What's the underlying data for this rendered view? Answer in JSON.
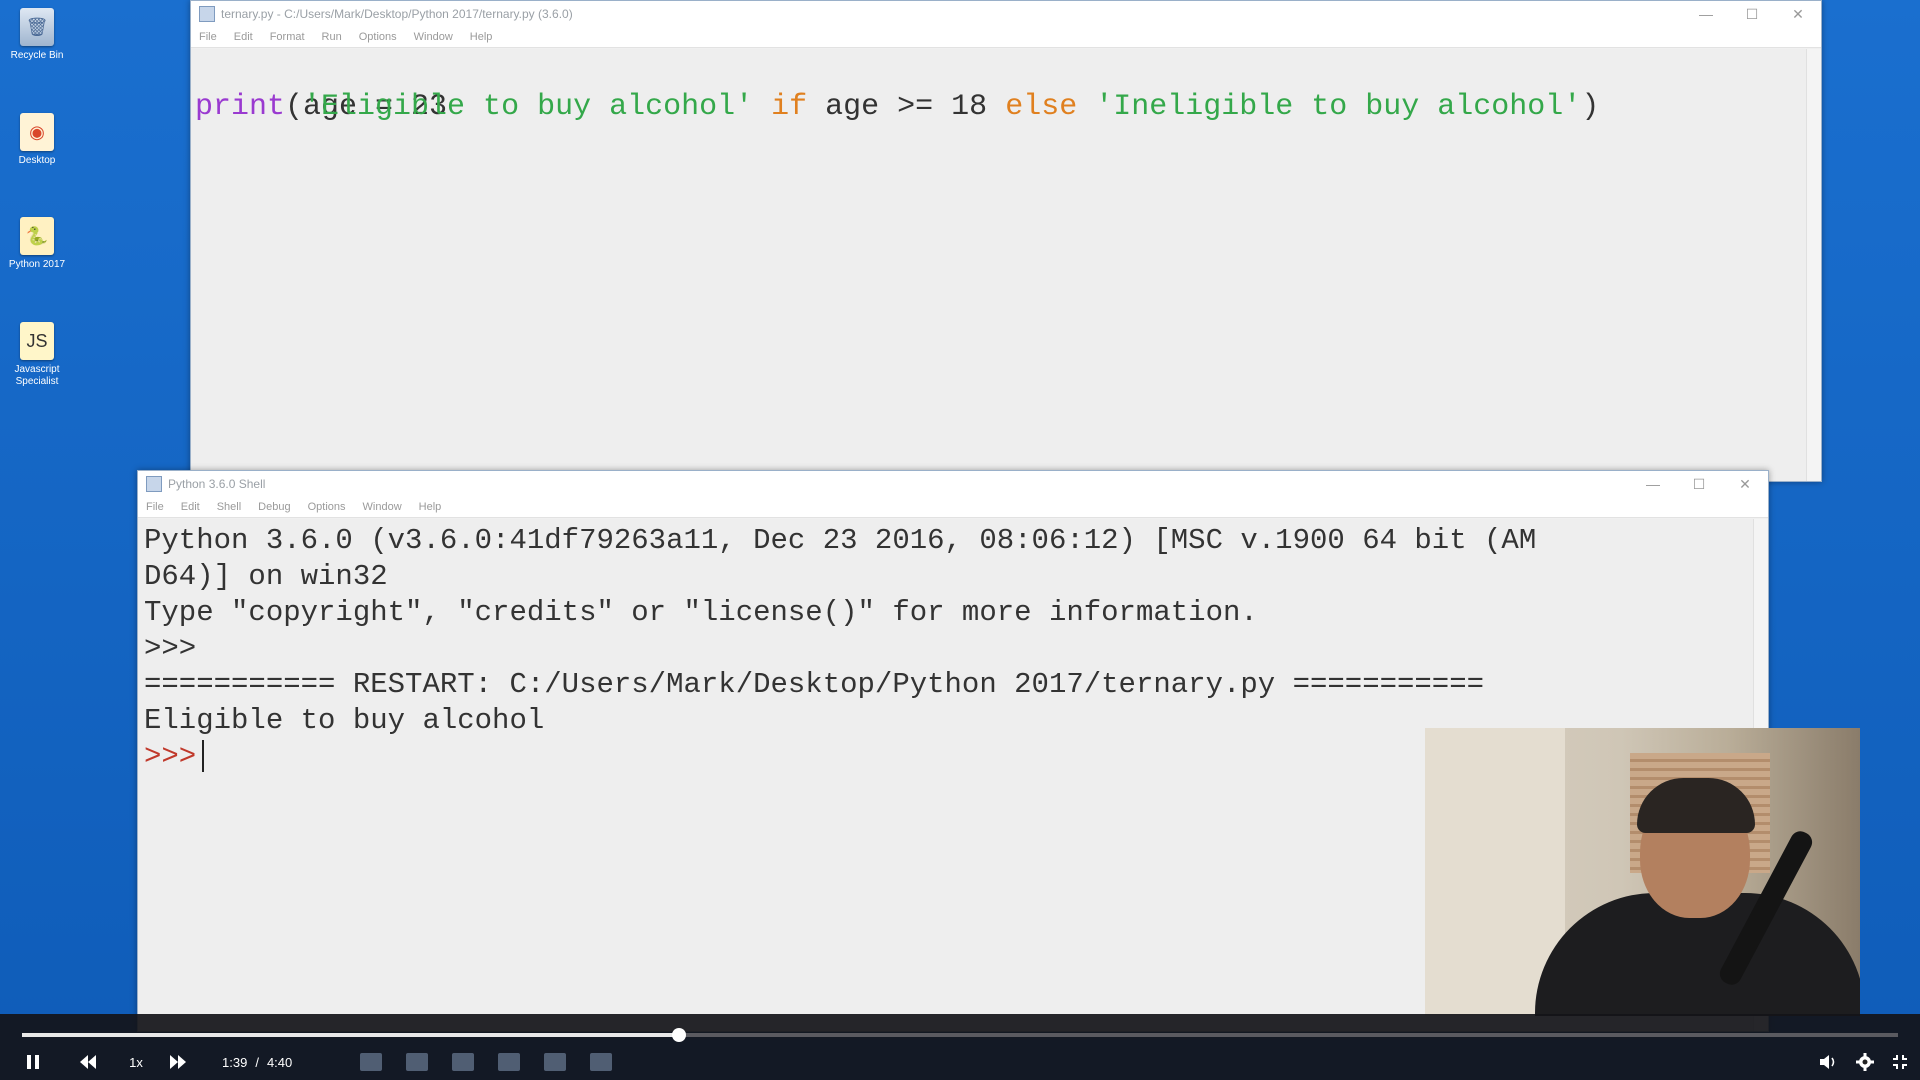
{
  "desktop": {
    "icons": [
      {
        "label": "Recycle Bin",
        "icon": "recycle-bin-icon"
      },
      {
        "label": "Desktop",
        "icon": "chrome-icon"
      },
      {
        "label": "Python 2017",
        "icon": "python-folder-icon"
      },
      {
        "label": "Javascript Specialist",
        "icon": "javascript-folder-icon"
      }
    ]
  },
  "editor": {
    "title": "ternary.py - C:/Users/Mark/Desktop/Python 2017/ternary.py (3.6.0)",
    "menu": [
      "File",
      "Edit",
      "Format",
      "Run",
      "Options",
      "Window",
      "Help"
    ],
    "code": {
      "line1": "age = 23",
      "print": "print",
      "open_paren": "(",
      "str1": "'Eligible to buy alcohol'",
      "kw_if": "if",
      "cond": "age >= 18",
      "kw_else": "else",
      "str2": "'Ineligible to buy alcohol'",
      "close_paren": ")"
    }
  },
  "shell": {
    "title": "Python 3.6.0 Shell",
    "menu": [
      "File",
      "Edit",
      "Shell",
      "Debug",
      "Options",
      "Window",
      "Help"
    ],
    "lines": {
      "banner1": "Python 3.6.0 (v3.6.0:41df79263a11, Dec 23 2016, 08:06:12) [MSC v.1900 64 bit (AM",
      "banner2": "D64)] on win32",
      "banner3": "Type \"copyright\", \"credits\" or \"license()\" for more information.",
      "prompt1": ">>>",
      "restart": "=========== RESTART: C:/Users/Mark/Desktop/Python 2017/ternary.py ===========",
      "output": "Eligible to buy alcohol",
      "prompt2": ">>>"
    }
  },
  "player": {
    "progress": 0.35,
    "speed": "1x",
    "current_time": "1:39",
    "separator": "/",
    "total_time": "4:40"
  },
  "colors": {
    "keyword": "#e0801f",
    "builtin": "#9a3ad0",
    "string": "#34a84a",
    "prompt": "#c0392b",
    "output": "#3b3bd6"
  }
}
